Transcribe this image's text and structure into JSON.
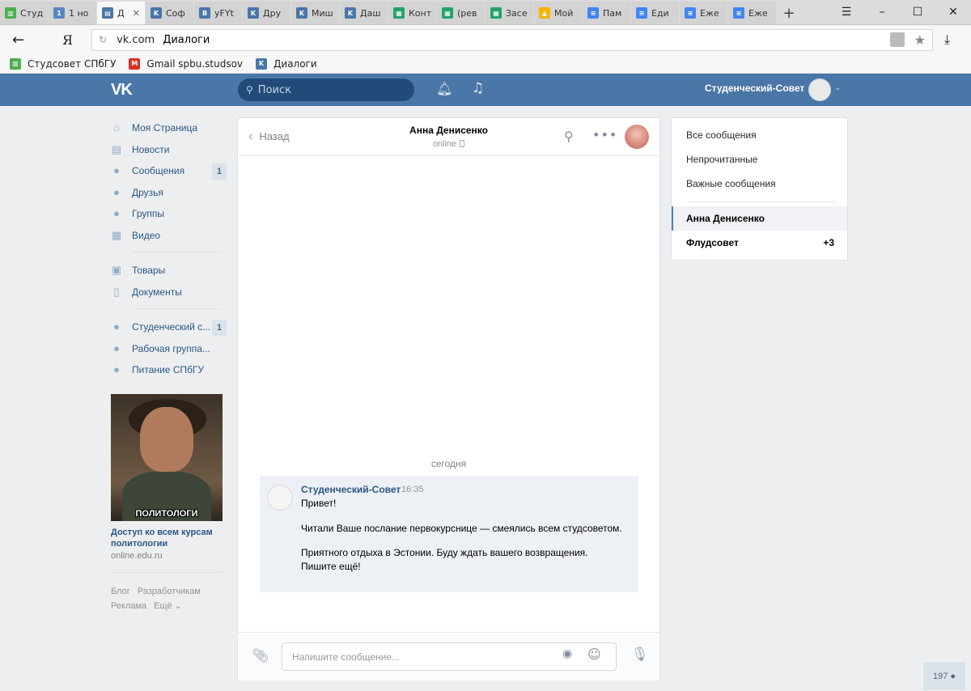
{
  "browser": {
    "tabs": [
      {
        "label": "Студ",
        "color": "#4caf50",
        "glyph": "▥",
        "active": false
      },
      {
        "label": "1 но",
        "color": "#5b86c5",
        "glyph": "1",
        "active": false
      },
      {
        "label": "Д",
        "color": "#4a76a8",
        "glyph": "▤",
        "active": true
      },
      {
        "label": "Соф",
        "color": "#4a76a8",
        "glyph": "K",
        "active": false
      },
      {
        "label": "yFYt",
        "color": "#4a76a8",
        "glyph": "B",
        "active": false
      },
      {
        "label": "Дру",
        "color": "#4a76a8",
        "glyph": "K",
        "active": false
      },
      {
        "label": "Миш",
        "color": "#4a76a8",
        "glyph": "K",
        "active": false
      },
      {
        "label": "Даш",
        "color": "#4a76a8",
        "glyph": "K",
        "active": false
      },
      {
        "label": "Конт",
        "color": "#21a366",
        "glyph": "▦",
        "active": false
      },
      {
        "label": "(рев",
        "color": "#21a366",
        "glyph": "▦",
        "active": false
      },
      {
        "label": "Засе",
        "color": "#21a366",
        "glyph": "▦",
        "active": false
      },
      {
        "label": "Мой",
        "color": "#f4b400",
        "glyph": "▲",
        "active": false
      },
      {
        "label": "Пам",
        "color": "#4285f4",
        "glyph": "≡",
        "active": false
      },
      {
        "label": "Еди",
        "color": "#4285f4",
        "glyph": "≡",
        "active": false
      },
      {
        "label": "Еже",
        "color": "#4285f4",
        "glyph": "≡",
        "active": false
      },
      {
        "label": "Еже",
        "color": "#4285f4",
        "glyph": "≡",
        "active": false
      }
    ],
    "address": {
      "host": "vk.com",
      "page_title": "Диалоги"
    },
    "bookmarks": [
      {
        "label": "Студсовет СПбГУ",
        "color": "#4caf50",
        "glyph": "▥"
      },
      {
        "label": "Gmail spbu.studsov",
        "color": "#d93025",
        "glyph": "M"
      },
      {
        "label": "Диалоги",
        "color": "#4a76a8",
        "glyph": "K"
      }
    ]
  },
  "header": {
    "search_placeholder": "Поиск",
    "user_name": "Студенческий-Совет"
  },
  "leftnav": {
    "main": [
      {
        "label": "Моя Страница",
        "icon": "home-icon",
        "glyph": "⌂",
        "badge": ""
      },
      {
        "label": "Новости",
        "icon": "news-icon",
        "glyph": "▤",
        "badge": ""
      },
      {
        "label": "Сообщения",
        "icon": "messages-icon",
        "glyph": "●",
        "badge": "1"
      },
      {
        "label": "Друзья",
        "icon": "friends-icon",
        "glyph": "●",
        "badge": ""
      },
      {
        "label": "Группы",
        "icon": "groups-icon",
        "glyph": "●",
        "badge": ""
      },
      {
        "label": "Видео",
        "icon": "video-icon",
        "glyph": "▦",
        "badge": ""
      }
    ],
    "secondary": [
      {
        "label": "Товары",
        "icon": "goods-icon",
        "glyph": "▣",
        "badge": ""
      },
      {
        "label": "Документы",
        "icon": "documents-icon",
        "glyph": "▯",
        "badge": ""
      }
    ],
    "groups": [
      {
        "label": "Студенческий с...",
        "icon": "group-icon",
        "glyph": "●",
        "badge": "1"
      },
      {
        "label": "Рабочая группа...",
        "icon": "group-icon",
        "glyph": "●",
        "badge": ""
      },
      {
        "label": "Питание СПбГУ",
        "icon": "group-icon",
        "glyph": "●",
        "badge": ""
      }
    ]
  },
  "ad": {
    "caption": "ПОЛИТОЛОГИ",
    "title": "Доступ ко всем курсам политологии",
    "domain": "online.edu.ru"
  },
  "footer_links": [
    "Блог",
    "Разработчикам",
    "Реклама",
    "Ещё ⌄"
  ],
  "chat": {
    "back_label": "Назад",
    "contact_name": "Анна Денисенко",
    "contact_status": "online",
    "day_label": "сегодня",
    "message": {
      "author": "Студенческий-Совет",
      "time": "16:35",
      "paragraphs": [
        "Привет!",
        "Читали Ваше послание первокурснице — смеялись всем студсоветом.",
        "Приятного отдыха в Эстонии. Буду ждать вашего возвращения. Пишите ещё!"
      ]
    },
    "input_placeholder": "Напишите сообщение..."
  },
  "rightmenu": {
    "filters": [
      "Все сообщения",
      "Непрочитанные",
      "Важные сообщения"
    ],
    "dialogs": [
      {
        "label": "Анна Денисенко",
        "count": "",
        "selected": true
      },
      {
        "label": "Флудсовет",
        "count": "+3",
        "selected": false
      }
    ]
  },
  "online_counter": "197"
}
